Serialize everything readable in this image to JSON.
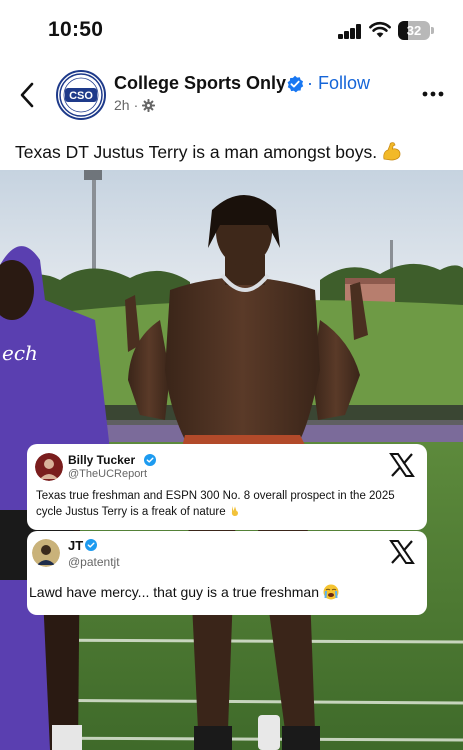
{
  "status_bar": {
    "time": "10:50",
    "battery": "32",
    "icons": [
      "signal-icon",
      "wifi-icon",
      "battery-icon"
    ]
  },
  "post": {
    "page_name": "College Sports Only",
    "avatar_text": "CSO",
    "follow_label": "Follow",
    "separator": "·",
    "timestamp": "2h",
    "meta_separator": "·",
    "caption": "Texas DT Justus Terry is a man amongst boys.",
    "caption_emoji_icon": "flexed-biceps-icon",
    "shirt_text": "ech",
    "accent_color": "#1565d8"
  },
  "tweets": [
    {
      "name": "Billy Tucker",
      "handle": "@TheUCReport",
      "text": "Texas true freshman and ESPN 300 No. 8 overall prospect in the 2025 cycle Justus Terry is a freak of nature",
      "emoji_icon": "victory-hand-icon",
      "verified": true
    },
    {
      "name": "JT",
      "handle": "@patentjt",
      "text": "Lawd have mercy... that guy is a true freshman",
      "emoji_icon": "loudly-crying-face-icon",
      "verified": true
    }
  ]
}
